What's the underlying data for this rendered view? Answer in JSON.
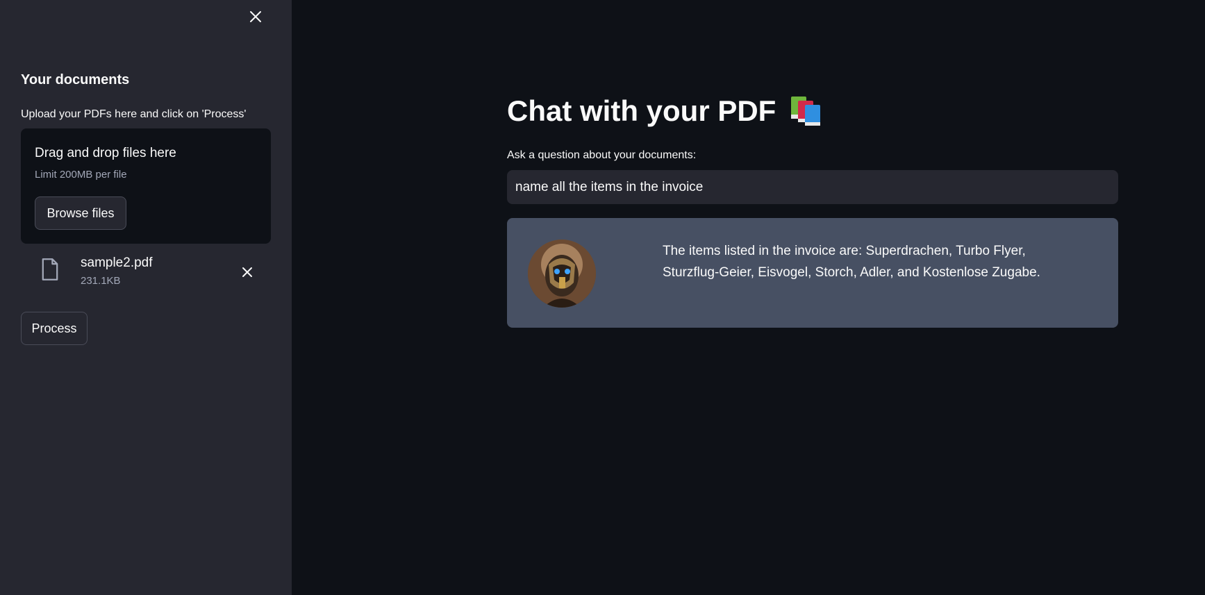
{
  "sidebar": {
    "title": "Your documents",
    "upload_label": "Upload your PDFs here and click on 'Process'",
    "dropzone": {
      "title": "Drag and drop files here",
      "limit": "Limit 200MB per file",
      "browse_label": "Browse files"
    },
    "file": {
      "name": "sample2.pdf",
      "size": "231.1KB"
    },
    "process_label": "Process"
  },
  "main": {
    "title": "Chat with your PDF",
    "title_icon": "books-icon",
    "question_label": "Ask a question about your documents:",
    "question_value": "name all the items in the invoice",
    "answer": "The items listed in the invoice are: Superdrachen, Turbo Flyer, Sturzflug-Geier, Eisvogel, Storch, Adler, and Kostenlose Zugabe."
  },
  "colors": {
    "background": "#0e1117",
    "sidebar": "#262730",
    "answer_box": "#475063",
    "text": "#fafafa",
    "muted": "#a3a8b8"
  }
}
